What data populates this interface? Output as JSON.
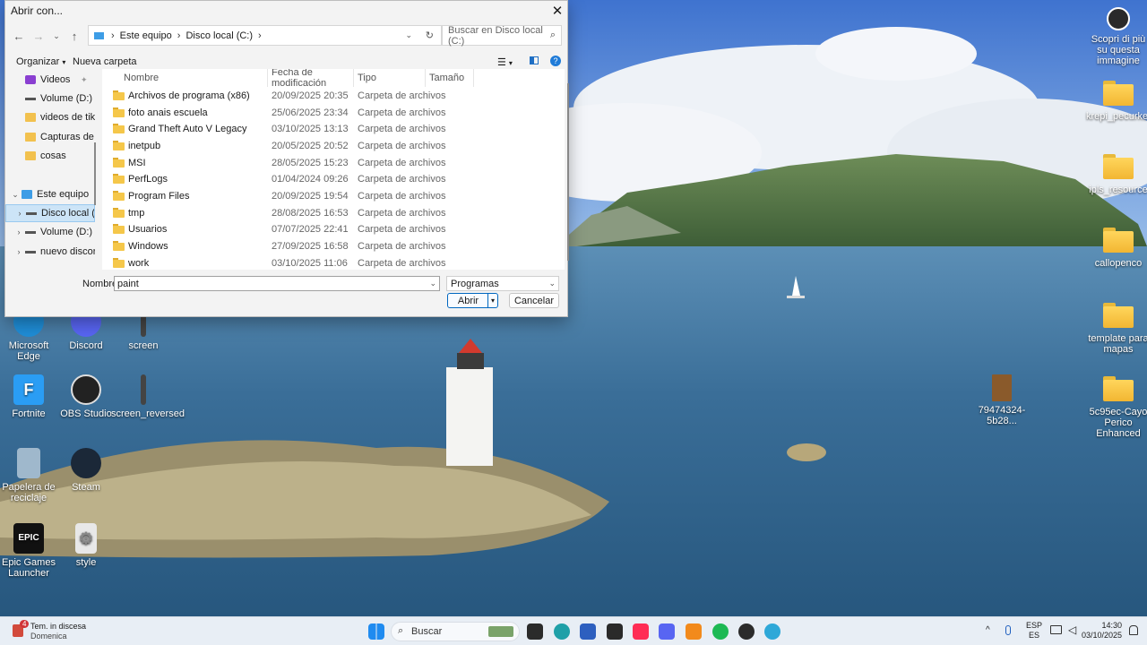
{
  "dialog": {
    "title": "Abrir con...",
    "close_icon": "close-icon",
    "address": [
      "Este equipo",
      "Disco local (C:)"
    ],
    "search_placeholder": "Buscar en Disco local (C:)",
    "toolbar": {
      "organize": "Organizar",
      "new_folder": "Nueva carpeta"
    },
    "tree": [
      {
        "label": "Videos",
        "icon": "video-folder-icon"
      },
      {
        "label": "Volume (D:)",
        "icon": "drive-icon"
      },
      {
        "label": "videos de tiktok",
        "icon": "folder-icon"
      },
      {
        "label": "Capturas de par",
        "icon": "folder-icon"
      },
      {
        "label": "cosas",
        "icon": "folder-icon"
      },
      {
        "label": "Este equipo",
        "icon": "pc-icon"
      },
      {
        "label": "Disco local (C:",
        "icon": "drive-icon"
      },
      {
        "label": "Volume (D:)",
        "icon": "drive-icon"
      },
      {
        "label": "nuevo discor (",
        "icon": "drive-icon"
      }
    ],
    "columns": {
      "name": "Nombre",
      "date": "Fecha de modificación",
      "type": "Tipo",
      "size": "Tamaño"
    },
    "files": [
      {
        "name": "Archivos de programa (x86)",
        "date": "20/09/2025 20:35",
        "type": "Carpeta de archivos"
      },
      {
        "name": "foto anais escuela",
        "date": "25/06/2025 23:34",
        "type": "Carpeta de archivos"
      },
      {
        "name": "Grand Theft Auto V Legacy",
        "date": "03/10/2025 13:13",
        "type": "Carpeta de archivos"
      },
      {
        "name": "inetpub",
        "date": "20/05/2025 20:52",
        "type": "Carpeta de archivos"
      },
      {
        "name": "MSI",
        "date": "28/05/2025 15:23",
        "type": "Carpeta de archivos"
      },
      {
        "name": "PerfLogs",
        "date": "01/04/2024 09:26",
        "type": "Carpeta de archivos"
      },
      {
        "name": "Program Files",
        "date": "20/09/2025 19:54",
        "type": "Carpeta de archivos"
      },
      {
        "name": "tmp",
        "date": "28/08/2025 16:53",
        "type": "Carpeta de archivos"
      },
      {
        "name": "Usuarios",
        "date": "07/07/2025 22:41",
        "type": "Carpeta de archivos"
      },
      {
        "name": "Windows",
        "date": "27/09/2025 16:58",
        "type": "Carpeta de archivos"
      },
      {
        "name": "work",
        "date": "03/10/2025 11:06",
        "type": "Carpeta de archivos"
      }
    ],
    "name_label": "Nombre:",
    "name_value": "paint",
    "file_type": "Programas",
    "open_button": "Abrir",
    "cancel_button": "Cancelar"
  },
  "desktop": {
    "left_icons": [
      {
        "label": "Microsoft Edge",
        "color": "#1f8dd6"
      },
      {
        "label": "Discord",
        "color": "#5865f2"
      },
      {
        "label": "screen",
        "color": "#444444"
      },
      {
        "label": "Fortnite",
        "color": "#2a9df4",
        "letter": "F"
      },
      {
        "label": "OBS Studio",
        "color": "#222222"
      },
      {
        "label": "screen_reversed",
        "color": "#444444"
      },
      {
        "label": "Papelera de reciclaje",
        "color": "#9fb8cc"
      },
      {
        "label": "Steam",
        "color": "#1b2838"
      },
      {
        "label": "Epic Games Launcher",
        "color": "#111111",
        "letter": "EPIC"
      },
      {
        "label": "style",
        "color": "#e8e8e8"
      }
    ],
    "right_icons": [
      {
        "label": "Scopri di più su questa immagine"
      },
      {
        "label": "krepi_pecurke..."
      },
      {
        "label": "ipls_resource"
      },
      {
        "label": "callopenco"
      },
      {
        "label": "template para mapas"
      },
      {
        "label": "5c95ec-Cayo Perico Enhanced"
      },
      {
        "label": "79474324-5b28..."
      }
    ]
  },
  "taskbar": {
    "weather_temp": "4",
    "weather_text": "Tem. in discesa",
    "weather_sub": "Domenica",
    "search_label": "Buscar",
    "lang_top": "ESP",
    "lang_bottom": "ES",
    "time": "14:30",
    "date": "03/10/2025"
  }
}
